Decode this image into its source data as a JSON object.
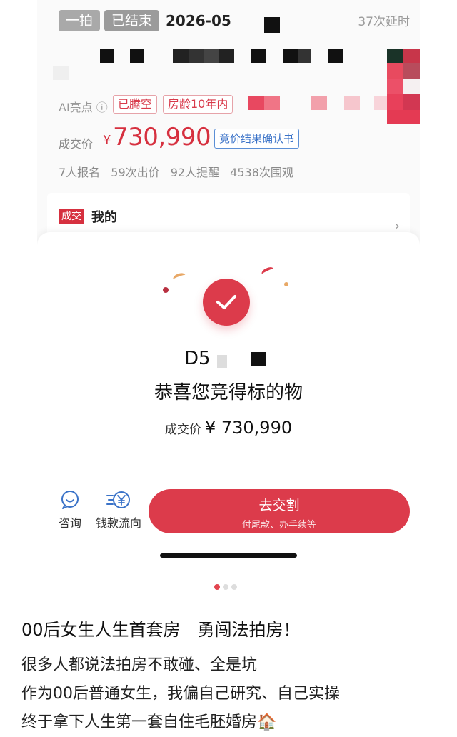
{
  "header": {
    "tag_first": "一拍",
    "tag_status": "已结束",
    "date": "2026-05",
    "delay": "37次延时"
  },
  "highlights": {
    "label": "AI亮点 ⓘ",
    "chips": [
      "已腾空",
      "房龄10年内"
    ]
  },
  "price": {
    "label": "成交价",
    "currency": "¥",
    "value": "730,990",
    "cert_label": "竞价结果确认书"
  },
  "stats": "7人报名 59次出价 92人提醒 4538次围观",
  "mine": {
    "badge": "成交",
    "text": "我的",
    "chevron": "›"
  },
  "success": {
    "icon": "check-icon",
    "lot_id": "D5",
    "message": "恭喜您竞得标的物",
    "price_label": "成交价",
    "price_value": "¥ 730,990"
  },
  "actions": {
    "consult_label": "咨询",
    "consult_icon": "chat-bubble-icon",
    "flow_label": "钱款流向",
    "flow_icon": "money-flow-icon",
    "go_label": "去交割",
    "go_sub": "付尾款、办手续等"
  },
  "post": {
    "title": "00后女生人生首套房｜勇闯法拍房！",
    "lines": [
      "很多人都说法拍房不敢碰、全是坑",
      "作为00后普通女生，我偏自己研究、自己实操",
      "终于拿下人生第一套自住毛胚婚房🏠"
    ]
  },
  "colors": {
    "accent": "#dc3b4b",
    "link_blue": "#3b73c8"
  }
}
